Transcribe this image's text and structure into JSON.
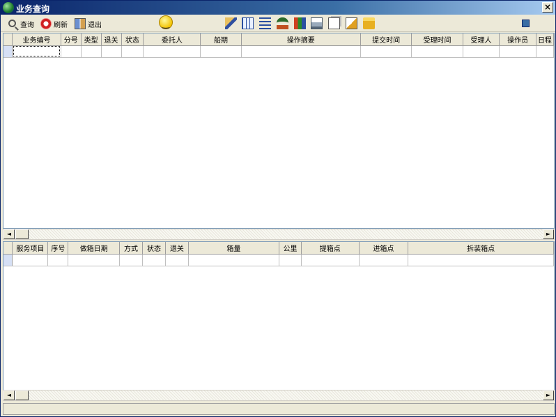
{
  "window": {
    "title": "业务查询",
    "close_label": "×"
  },
  "toolbar": {
    "query_label": "查询",
    "refresh_label": "刷新",
    "exit_label": "退出"
  },
  "top_grid": {
    "columns": [
      "业务编号",
      "分号",
      "类型",
      "退关",
      "状态",
      "委托人",
      "船期",
      "操作摘要",
      "提交时间",
      "受理时间",
      "受理人",
      "操作员",
      "日程"
    ]
  },
  "bottom_grid": {
    "columns": [
      "服务项目",
      "序号",
      "做箱日期",
      "方式",
      "状态",
      "退关",
      "箱量",
      "公里",
      "提箱点",
      "进箱点",
      "拆装箱点"
    ]
  },
  "scrollbar": {
    "left_arrow": "◄",
    "right_arrow": "►"
  },
  "colors": {
    "title_start": "#0a246a",
    "title_end": "#a6caf0",
    "grid_border": "#7f9db9",
    "chrome": "#ece9d8"
  }
}
